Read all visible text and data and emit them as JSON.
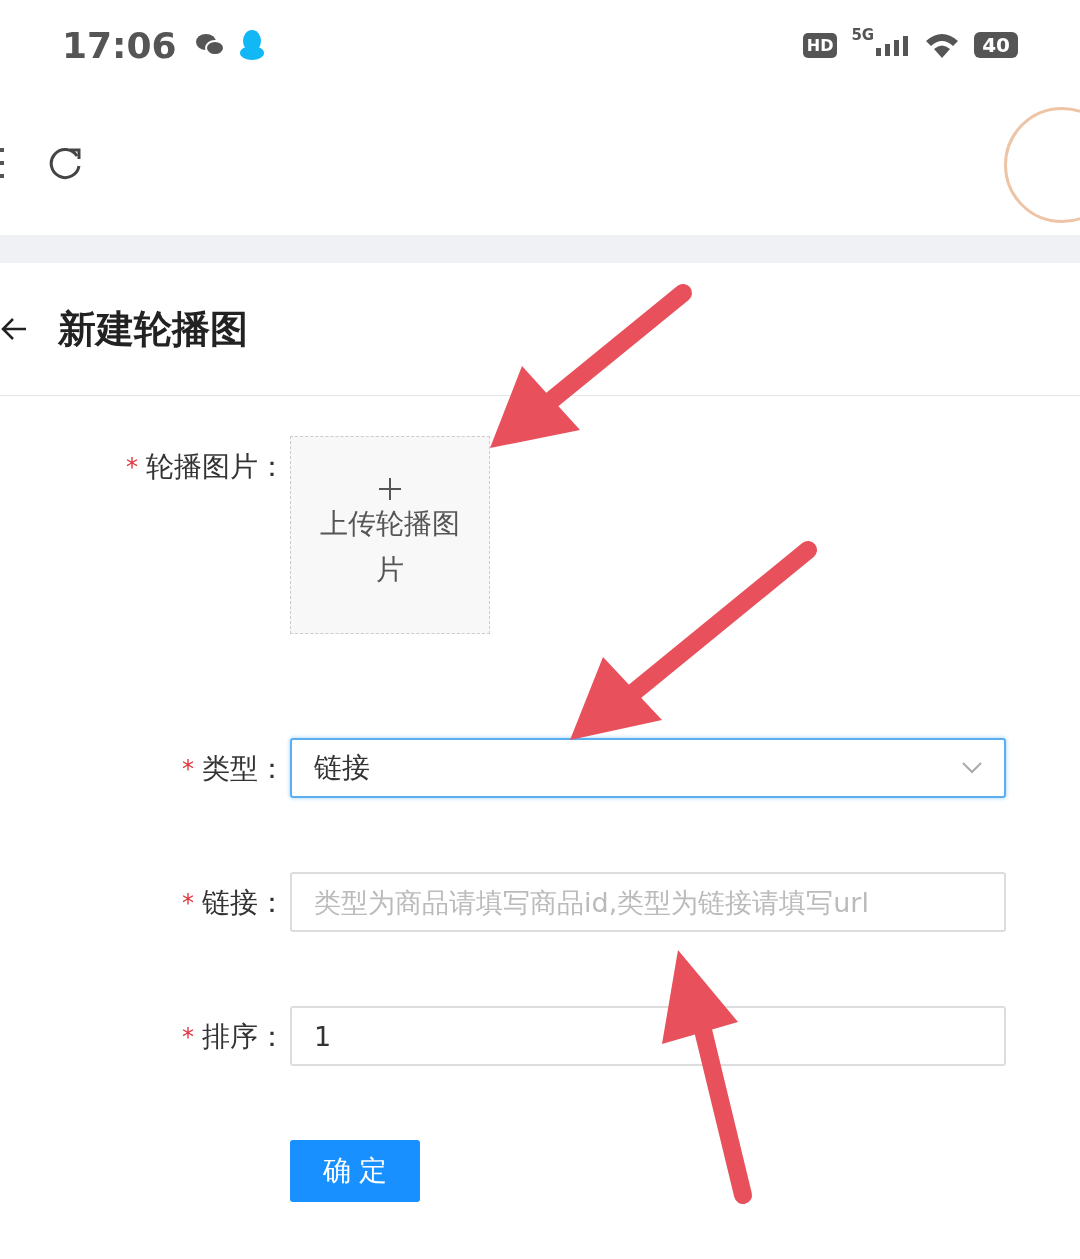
{
  "status_bar": {
    "time": "17:06",
    "hd": "HD",
    "network": "5G",
    "battery": "40"
  },
  "page_header": {
    "title": "新建轮播图"
  },
  "form": {
    "fields": [
      {
        "kind": "upload",
        "label": "轮播图片：",
        "required_mark": "*",
        "upload_text": "上传轮播图片"
      },
      {
        "kind": "select",
        "label": "类型：",
        "required_mark": "*",
        "value": "链接",
        "focused": true
      },
      {
        "kind": "input",
        "label": "链接：",
        "required_mark": "*",
        "placeholder": "类型为商品请填写商品id,类型为链接请填写url",
        "focused": false
      },
      {
        "kind": "input",
        "label": "排序：",
        "required_mark": "*",
        "value": "1",
        "focused": false
      }
    ],
    "submit": "确 定"
  }
}
